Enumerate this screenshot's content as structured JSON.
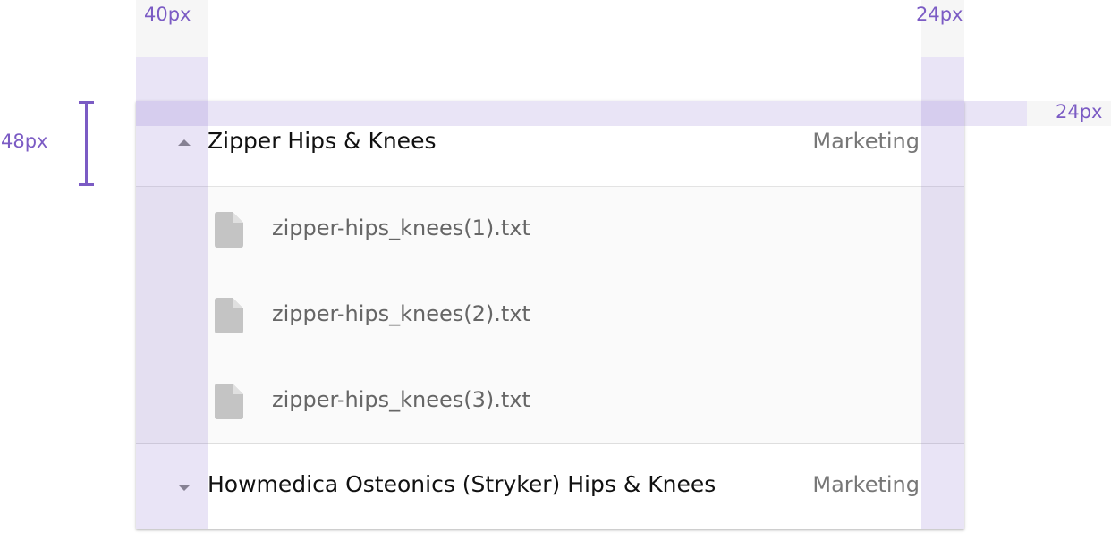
{
  "spec": {
    "left_padding_label": "40px",
    "right_padding_label": "24px",
    "top_padding_label": "24px",
    "row_height_label": "48px"
  },
  "list": {
    "groups": [
      {
        "title": "Zipper Hips & Knees",
        "category": "Marketing",
        "expanded": true,
        "files": [
          "zipper-hips_knees(1).txt",
          "zipper-hips_knees(2).txt",
          "zipper-hips_knees(3).txt"
        ]
      },
      {
        "title": "Howmedica Osteonics (Stryker) Hips & Knees",
        "category": "Marketing",
        "expanded": false,
        "files": []
      }
    ]
  },
  "colors": {
    "overlay": "#7b5bc4",
    "icon": "#c4c4c4"
  },
  "icons": {
    "expanded": "caret-up-icon",
    "collapsed": "caret-down-icon",
    "file": "file-icon"
  }
}
